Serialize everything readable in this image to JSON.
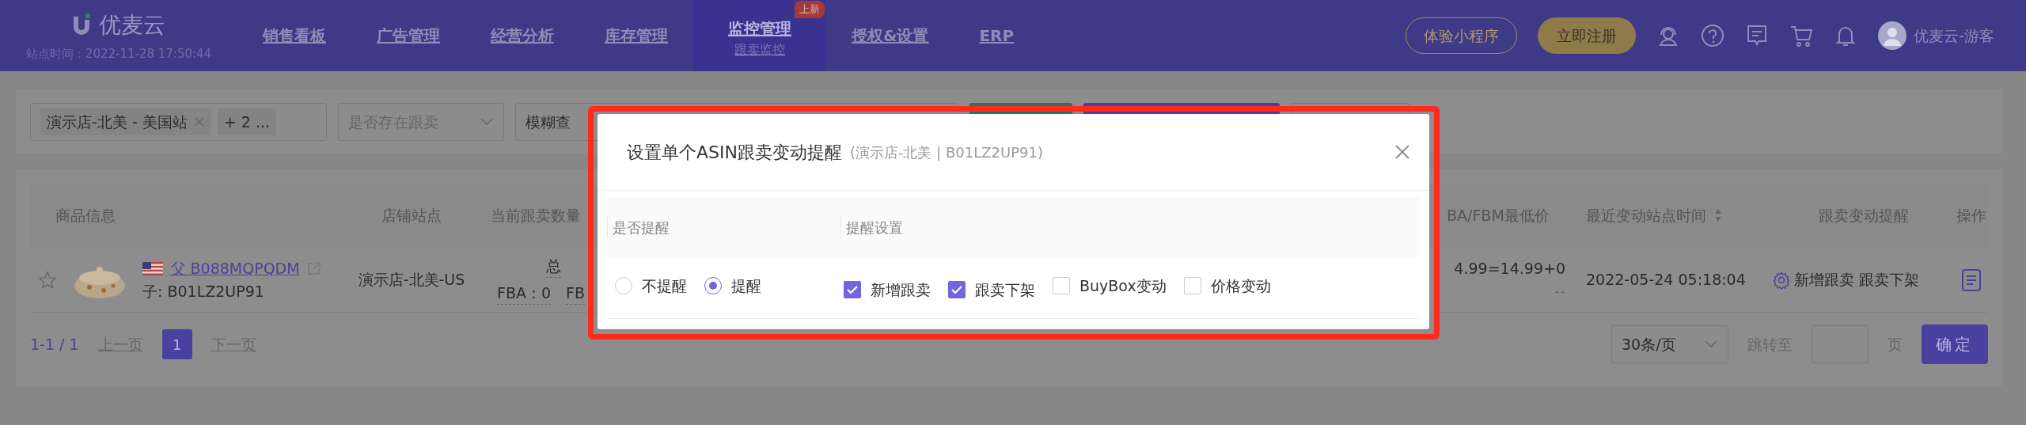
{
  "nav": {
    "logo": "优麦云",
    "site_time": "站点时间：2022-11-28 17:50:44",
    "items": [
      {
        "label": "销售看板",
        "selected": false
      },
      {
        "label": "广告管理",
        "selected": false
      },
      {
        "label": "经营分析",
        "selected": false
      },
      {
        "label": "库存管理",
        "selected": false
      },
      {
        "label": "监控管理",
        "selected": true,
        "sub": "跟卖监控",
        "badge": "上新"
      },
      {
        "label": "授权&设置",
        "selected": false
      },
      {
        "label": "ERP",
        "selected": false
      }
    ],
    "trial_button": "体验小程序",
    "register_button": "立即注册",
    "user": "优麦云-游客"
  },
  "filters": {
    "store_tag": "演示店-北美 - 美国站",
    "more_tag": "+ 2 ...",
    "exists_select": {
      "placeholder": "是否存在跟卖"
    },
    "query_select": "模糊查"
  },
  "table": {
    "columns": [
      "商品信息",
      "店铺站点",
      "当前跟卖数量",
      "BA/FBM最低价",
      "最近变动站点时间",
      "跟卖变动提醒",
      "操作"
    ],
    "rows": [
      {
        "starred": false,
        "parent_asin": "父 B088MQPQDM",
        "child_asin": "子: B01LZ2UP91",
        "store": "演示店-北美-US",
        "count_total": "总",
        "count_fba": "FBA：0",
        "count_fbm": "FB",
        "price": "4.99=14.99+0",
        "price_sub": "--",
        "time": "2022-05-24 05:18:04",
        "reminder": "新增跟卖 跟卖下架"
      }
    ]
  },
  "pagination": {
    "range": "1-1 / 1",
    "prev": "上一页",
    "pages": [
      {
        "label": "1",
        "selected": true
      }
    ],
    "next": "下一页",
    "page_size": "30条/页",
    "jump_label": "跳转至",
    "page_unit": "页",
    "confirm": "确定"
  },
  "modal": {
    "title": "设置单个ASIN跟卖变动提醒",
    "subtitle": "(演示店-北美 | B01LZ2UP91)",
    "columns": [
      "是否提醒",
      "提醒设置"
    ],
    "radios": [
      {
        "label": "不提醒",
        "selected": false
      },
      {
        "label": "提醒",
        "selected": true
      }
    ],
    "checkboxes": [
      {
        "label": "新增跟卖",
        "checked": true
      },
      {
        "label": "跟卖下架",
        "checked": true
      },
      {
        "label": "BuyBox变动",
        "checked": false
      },
      {
        "label": "价格变动",
        "checked": false
      }
    ]
  }
}
